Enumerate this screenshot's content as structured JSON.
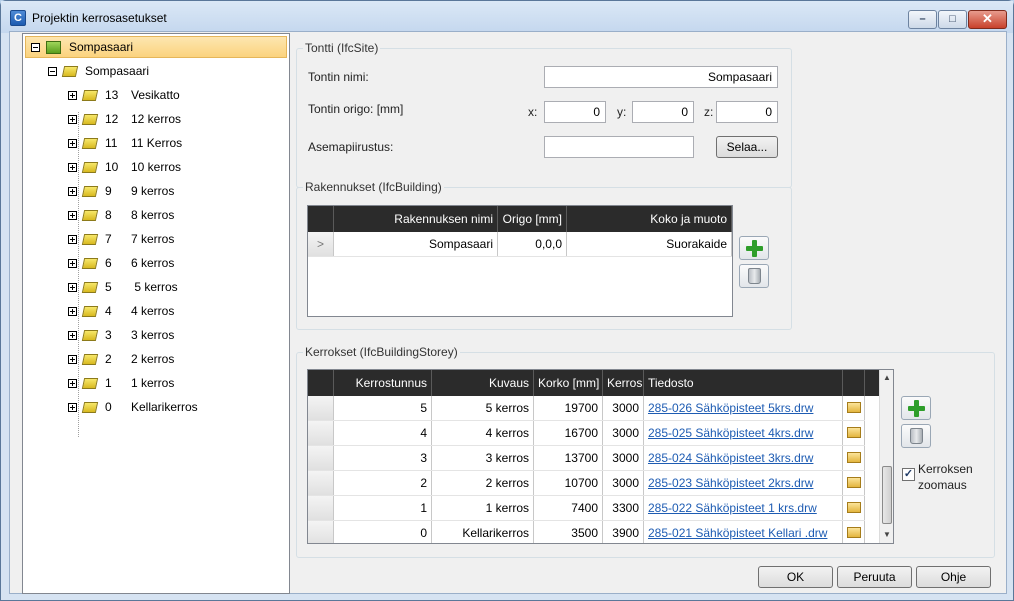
{
  "window": {
    "title": "Projektin kerrosasetukset",
    "app_icon_letter": "C"
  },
  "tree": {
    "root": {
      "label": "Sompasaari"
    },
    "building": {
      "label": "Sompasaari"
    },
    "storeys": [
      {
        "num": "13",
        "label": "Vesikatto"
      },
      {
        "num": "12",
        "label": "12 kerros"
      },
      {
        "num": "11",
        "label": "11 Kerros"
      },
      {
        "num": "10",
        "label": "10 kerros"
      },
      {
        "num": "9",
        "label": "9 kerros"
      },
      {
        "num": "8",
        "label": "8 kerros"
      },
      {
        "num": "7",
        "label": "7 kerros"
      },
      {
        "num": "6",
        "label": "6 kerros"
      },
      {
        "num": "5",
        "label": " 5 kerros"
      },
      {
        "num": "4",
        "label": "4 kerros"
      },
      {
        "num": "3",
        "label": "3 kerros"
      },
      {
        "num": "2",
        "label": "2 kerros"
      },
      {
        "num": "1",
        "label": "1 kerros"
      },
      {
        "num": "0",
        "label": "Kellarikerros"
      }
    ]
  },
  "site": {
    "group_label": "Tontti (IfcSite)",
    "name_label": "Tontin nimi:",
    "name_value": "Sompasaari",
    "origin_label": "Tontin origo: [mm]",
    "x_label": "x:",
    "x_value": "0",
    "y_label": "y:",
    "y_value": "0",
    "z_label": "z:",
    "z_value": "0",
    "plan_label": "Asemapiirustus:",
    "plan_value": "",
    "browse_button": "Selaa..."
  },
  "buildings": {
    "group_label": "Rakennukset (IfcBuilding)",
    "columns": [
      "Rakennuksen nimi",
      "Origo [mm]",
      "Koko ja muoto"
    ],
    "rows": [
      {
        "indicator": ">",
        "name": "Sompasaari",
        "origin": "0,0,0",
        "shape": "Suorakaide"
      }
    ]
  },
  "storeys": {
    "group_label": "Kerrokset (IfcBuildingStorey)",
    "columns": [
      "Kerrostunnus",
      "Kuvaus",
      "Korko [mm]",
      "Kerros",
      "Tiedosto"
    ],
    "rows": [
      {
        "id": "5",
        "desc": "5 kerros",
        "elev": "19700",
        "height": "3000",
        "file": "285-026 Sähköpisteet 5krs.drw"
      },
      {
        "id": "4",
        "desc": "4 kerros",
        "elev": "16700",
        "height": "3000",
        "file": "285-025 Sähköpisteet 4krs.drw"
      },
      {
        "id": "3",
        "desc": "3 kerros",
        "elev": "13700",
        "height": "3000",
        "file": "285-024 Sähköpisteet 3krs.drw"
      },
      {
        "id": "2",
        "desc": "2 kerros",
        "elev": "10700",
        "height": "3000",
        "file": "285-023 Sähköpisteet 2krs.drw"
      },
      {
        "id": "1",
        "desc": "1 kerros",
        "elev": "7400",
        "height": "3300",
        "file": "285-022 Sähköpisteet 1 krs.drw"
      },
      {
        "id": "0",
        "desc": "Kellarikerros",
        "elev": "3500",
        "height": "3900",
        "file": "285-021 Sähköpisteet Kellari .drw"
      }
    ],
    "zoom_checkbox_label_line1": "Kerroksen",
    "zoom_checkbox_label_line2": "zoomaus",
    "zoom_checked": true,
    "check_mark": "✓"
  },
  "footer": {
    "ok": "OK",
    "cancel": "Peruuta",
    "help": "Ohje"
  },
  "titlebar_buttons": {
    "minimize": "–",
    "maximize": "□",
    "close": "✕"
  },
  "scroll_arrows": {
    "up": "▲",
    "down": "▼"
  }
}
